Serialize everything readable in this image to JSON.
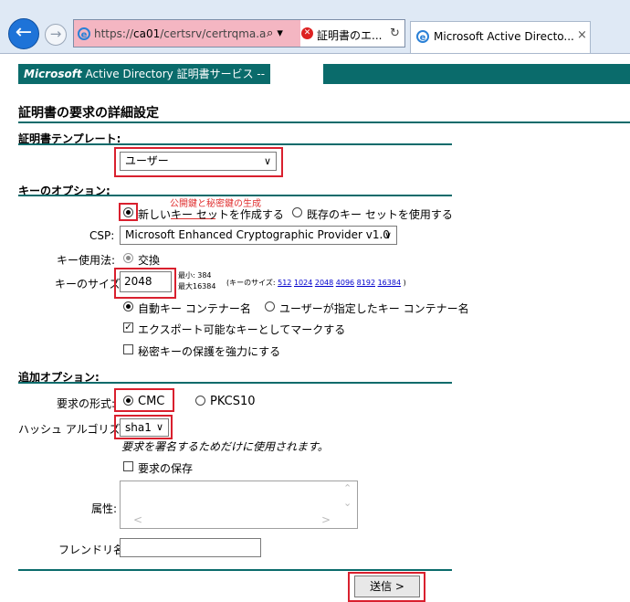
{
  "browser": {
    "url_prefix": "https://",
    "url_host": "ca01",
    "url_rest": "/certsrv/certrqma.a",
    "search_symbol": "⌕ ▾",
    "tab1_title": "証明書のエ...",
    "reload_symbol": "↻",
    "tab2_title": "Microsoft Active Directo...",
    "close_symbol": "×"
  },
  "banner": {
    "brand": "Microsoft",
    "title": "Active Directory 証明書サービス  --"
  },
  "page_title": "証明書の要求の詳細設定",
  "template_section": {
    "heading": "証明書テンプレート:",
    "selected": "ユーザー"
  },
  "key_options": {
    "heading": "キーのオプション:",
    "annotation": "公開鍵と秘密鍵の生成",
    "new_keyset": "新しいキー セットを作成する",
    "existing_keyset": "既存のキー セットを使用する",
    "csp_label": "CSP:",
    "csp_value": "Microsoft Enhanced Cryptographic Provider v1.0",
    "key_usage_label": "キー使用法:",
    "key_usage_value": "交換",
    "key_size_label": "キーのサイズ:",
    "key_size_value": "2048",
    "min_label": "最小:    384",
    "max_label": "最大16384",
    "common_sizes_prefix": "(キーのサイズ:",
    "common_sizes": [
      "512",
      "1024",
      "2048",
      "4096",
      "8192",
      "16384"
    ],
    "common_sizes_suffix": ")",
    "auto_container": "自動キー コンテナー名",
    "user_container": "ユーザーが指定したキー コンテナー名",
    "exportable": "エクスポート可能なキーとしてマークする",
    "strong_protection": "秘密キーの保護を強力にする",
    "checkmark": "✓"
  },
  "additional_options": {
    "heading": "追加オプション:",
    "request_format_label": "要求の形式:",
    "format_cmc": "CMC",
    "format_pkcs10": "PKCS10",
    "hash_label": "ハッシュ アルゴリズム:",
    "hash_value": "sha1",
    "hash_note": "要求を署名するためだけに使用されます。",
    "save_request": "要求の保存",
    "attributes_label": "属性:",
    "friendly_name_label": "フレンドリ名:"
  },
  "submit_label": "送信 >",
  "chevron": "∨"
}
